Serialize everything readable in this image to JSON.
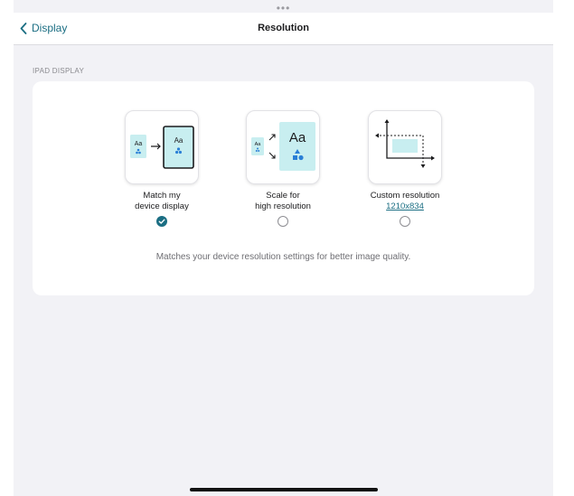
{
  "header": {
    "grabber": "•••",
    "back_label": "Display",
    "title": "Resolution"
  },
  "section": {
    "label": "IPAD DISPLAY"
  },
  "options": [
    {
      "line1": "Match my",
      "line2": "device display",
      "selected": true,
      "icon": "match-device-display-icon"
    },
    {
      "line1": "Scale for",
      "line2": "high resolution",
      "selected": false,
      "icon": "scale-high-resolution-icon"
    },
    {
      "line1": "Custom resolution",
      "link": "1210x834",
      "selected": false,
      "icon": "custom-resolution-icon"
    }
  ],
  "icon_text": {
    "aa": "Aa"
  },
  "footnote": "Matches your device resolution settings for better image quality.",
  "colors": {
    "accent": "#1b6e83",
    "tile_fill": "#c8eef0"
  }
}
